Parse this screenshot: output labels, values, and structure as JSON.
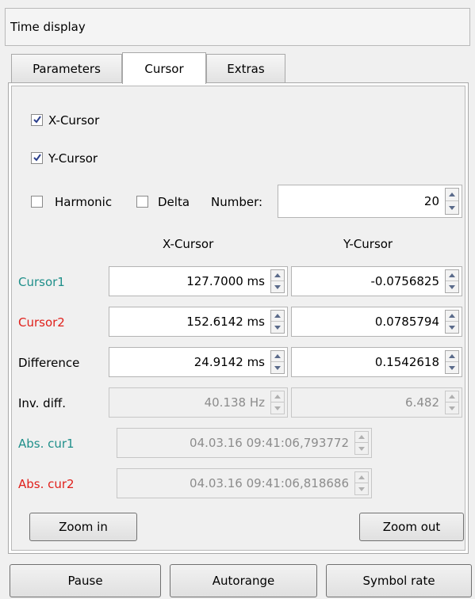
{
  "window": {
    "title": "Time display"
  },
  "tabs": [
    {
      "label": "Parameters",
      "active": false
    },
    {
      "label": "Cursor",
      "active": true
    },
    {
      "label": "Extras",
      "active": false
    }
  ],
  "options": {
    "x_cursor": {
      "label": "X-Cursor",
      "checked": true
    },
    "y_cursor": {
      "label": "Y-Cursor",
      "checked": true
    },
    "harmonic": {
      "label": "Harmonic",
      "checked": false
    },
    "delta": {
      "label": "Delta",
      "checked": false
    },
    "number": {
      "label": "Number:",
      "value": "20"
    }
  },
  "table": {
    "col_headers": [
      "X-Cursor",
      "Y-Cursor"
    ],
    "rows": [
      {
        "label": "Cursor1",
        "label_color": "#1f8f8a",
        "x": "127.7000 ms",
        "y": "-0.0756825",
        "enabled": true
      },
      {
        "label": "Cursor2",
        "label_color": "#e0201b",
        "x": "152.6142 ms",
        "y": "0.0785794",
        "enabled": true
      },
      {
        "label": "Difference",
        "label_color": "#000000",
        "x": "24.9142 ms",
        "y": "0.1542618",
        "enabled": true
      },
      {
        "label": "Inv. diff.",
        "label_color": "#000000",
        "x": "40.138 Hz",
        "y": "6.482",
        "enabled": false
      }
    ],
    "abs": [
      {
        "label": "Abs. cur1",
        "label_color": "#1f8f8a",
        "value": "04.03.16 09:41:06,793772"
      },
      {
        "label": "Abs. cur2",
        "label_color": "#e0201b",
        "value": "04.03.16 09:41:06,818686"
      }
    ]
  },
  "zoom": {
    "in_label": "Zoom in",
    "out_label": "Zoom out"
  },
  "footer": {
    "pause_label": "Pause",
    "autorange_label": "Autorange",
    "symbol_rate_label": "Symbol rate"
  }
}
